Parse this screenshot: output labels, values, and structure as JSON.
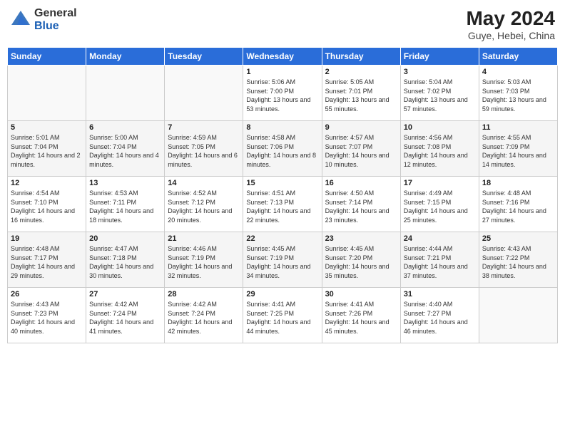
{
  "header": {
    "logo_general": "General",
    "logo_blue": "Blue",
    "month_title": "May 2024",
    "location": "Guye, Hebei, China"
  },
  "calendar": {
    "weekdays": [
      "Sunday",
      "Monday",
      "Tuesday",
      "Wednesday",
      "Thursday",
      "Friday",
      "Saturday"
    ],
    "weeks": [
      [
        {
          "day": "",
          "info": ""
        },
        {
          "day": "",
          "info": ""
        },
        {
          "day": "",
          "info": ""
        },
        {
          "day": "1",
          "sunrise": "Sunrise: 5:06 AM",
          "sunset": "Sunset: 7:00 PM",
          "daylight": "Daylight: 13 hours and 53 minutes."
        },
        {
          "day": "2",
          "sunrise": "Sunrise: 5:05 AM",
          "sunset": "Sunset: 7:01 PM",
          "daylight": "Daylight: 13 hours and 55 minutes."
        },
        {
          "day": "3",
          "sunrise": "Sunrise: 5:04 AM",
          "sunset": "Sunset: 7:02 PM",
          "daylight": "Daylight: 13 hours and 57 minutes."
        },
        {
          "day": "4",
          "sunrise": "Sunrise: 5:03 AM",
          "sunset": "Sunset: 7:03 PM",
          "daylight": "Daylight: 13 hours and 59 minutes."
        }
      ],
      [
        {
          "day": "5",
          "sunrise": "Sunrise: 5:01 AM",
          "sunset": "Sunset: 7:04 PM",
          "daylight": "Daylight: 14 hours and 2 minutes."
        },
        {
          "day": "6",
          "sunrise": "Sunrise: 5:00 AM",
          "sunset": "Sunset: 7:04 PM",
          "daylight": "Daylight: 14 hours and 4 minutes."
        },
        {
          "day": "7",
          "sunrise": "Sunrise: 4:59 AM",
          "sunset": "Sunset: 7:05 PM",
          "daylight": "Daylight: 14 hours and 6 minutes."
        },
        {
          "day": "8",
          "sunrise": "Sunrise: 4:58 AM",
          "sunset": "Sunset: 7:06 PM",
          "daylight": "Daylight: 14 hours and 8 minutes."
        },
        {
          "day": "9",
          "sunrise": "Sunrise: 4:57 AM",
          "sunset": "Sunset: 7:07 PM",
          "daylight": "Daylight: 14 hours and 10 minutes."
        },
        {
          "day": "10",
          "sunrise": "Sunrise: 4:56 AM",
          "sunset": "Sunset: 7:08 PM",
          "daylight": "Daylight: 14 hours and 12 minutes."
        },
        {
          "day": "11",
          "sunrise": "Sunrise: 4:55 AM",
          "sunset": "Sunset: 7:09 PM",
          "daylight": "Daylight: 14 hours and 14 minutes."
        }
      ],
      [
        {
          "day": "12",
          "sunrise": "Sunrise: 4:54 AM",
          "sunset": "Sunset: 7:10 PM",
          "daylight": "Daylight: 14 hours and 16 minutes."
        },
        {
          "day": "13",
          "sunrise": "Sunrise: 4:53 AM",
          "sunset": "Sunset: 7:11 PM",
          "daylight": "Daylight: 14 hours and 18 minutes."
        },
        {
          "day": "14",
          "sunrise": "Sunrise: 4:52 AM",
          "sunset": "Sunset: 7:12 PM",
          "daylight": "Daylight: 14 hours and 20 minutes."
        },
        {
          "day": "15",
          "sunrise": "Sunrise: 4:51 AM",
          "sunset": "Sunset: 7:13 PM",
          "daylight": "Daylight: 14 hours and 22 minutes."
        },
        {
          "day": "16",
          "sunrise": "Sunrise: 4:50 AM",
          "sunset": "Sunset: 7:14 PM",
          "daylight": "Daylight: 14 hours and 23 minutes."
        },
        {
          "day": "17",
          "sunrise": "Sunrise: 4:49 AM",
          "sunset": "Sunset: 7:15 PM",
          "daylight": "Daylight: 14 hours and 25 minutes."
        },
        {
          "day": "18",
          "sunrise": "Sunrise: 4:48 AM",
          "sunset": "Sunset: 7:16 PM",
          "daylight": "Daylight: 14 hours and 27 minutes."
        }
      ],
      [
        {
          "day": "19",
          "sunrise": "Sunrise: 4:48 AM",
          "sunset": "Sunset: 7:17 PM",
          "daylight": "Daylight: 14 hours and 29 minutes."
        },
        {
          "day": "20",
          "sunrise": "Sunrise: 4:47 AM",
          "sunset": "Sunset: 7:18 PM",
          "daylight": "Daylight: 14 hours and 30 minutes."
        },
        {
          "day": "21",
          "sunrise": "Sunrise: 4:46 AM",
          "sunset": "Sunset: 7:19 PM",
          "daylight": "Daylight: 14 hours and 32 minutes."
        },
        {
          "day": "22",
          "sunrise": "Sunrise: 4:45 AM",
          "sunset": "Sunset: 7:19 PM",
          "daylight": "Daylight: 14 hours and 34 minutes."
        },
        {
          "day": "23",
          "sunrise": "Sunrise: 4:45 AM",
          "sunset": "Sunset: 7:20 PM",
          "daylight": "Daylight: 14 hours and 35 minutes."
        },
        {
          "day": "24",
          "sunrise": "Sunrise: 4:44 AM",
          "sunset": "Sunset: 7:21 PM",
          "daylight": "Daylight: 14 hours and 37 minutes."
        },
        {
          "day": "25",
          "sunrise": "Sunrise: 4:43 AM",
          "sunset": "Sunset: 7:22 PM",
          "daylight": "Daylight: 14 hours and 38 minutes."
        }
      ],
      [
        {
          "day": "26",
          "sunrise": "Sunrise: 4:43 AM",
          "sunset": "Sunset: 7:23 PM",
          "daylight": "Daylight: 14 hours and 40 minutes."
        },
        {
          "day": "27",
          "sunrise": "Sunrise: 4:42 AM",
          "sunset": "Sunset: 7:24 PM",
          "daylight": "Daylight: 14 hours and 41 minutes."
        },
        {
          "day": "28",
          "sunrise": "Sunrise: 4:42 AM",
          "sunset": "Sunset: 7:24 PM",
          "daylight": "Daylight: 14 hours and 42 minutes."
        },
        {
          "day": "29",
          "sunrise": "Sunrise: 4:41 AM",
          "sunset": "Sunset: 7:25 PM",
          "daylight": "Daylight: 14 hours and 44 minutes."
        },
        {
          "day": "30",
          "sunrise": "Sunrise: 4:41 AM",
          "sunset": "Sunset: 7:26 PM",
          "daylight": "Daylight: 14 hours and 45 minutes."
        },
        {
          "day": "31",
          "sunrise": "Sunrise: 4:40 AM",
          "sunset": "Sunset: 7:27 PM",
          "daylight": "Daylight: 14 hours and 46 minutes."
        },
        {
          "day": "",
          "info": ""
        }
      ]
    ]
  }
}
